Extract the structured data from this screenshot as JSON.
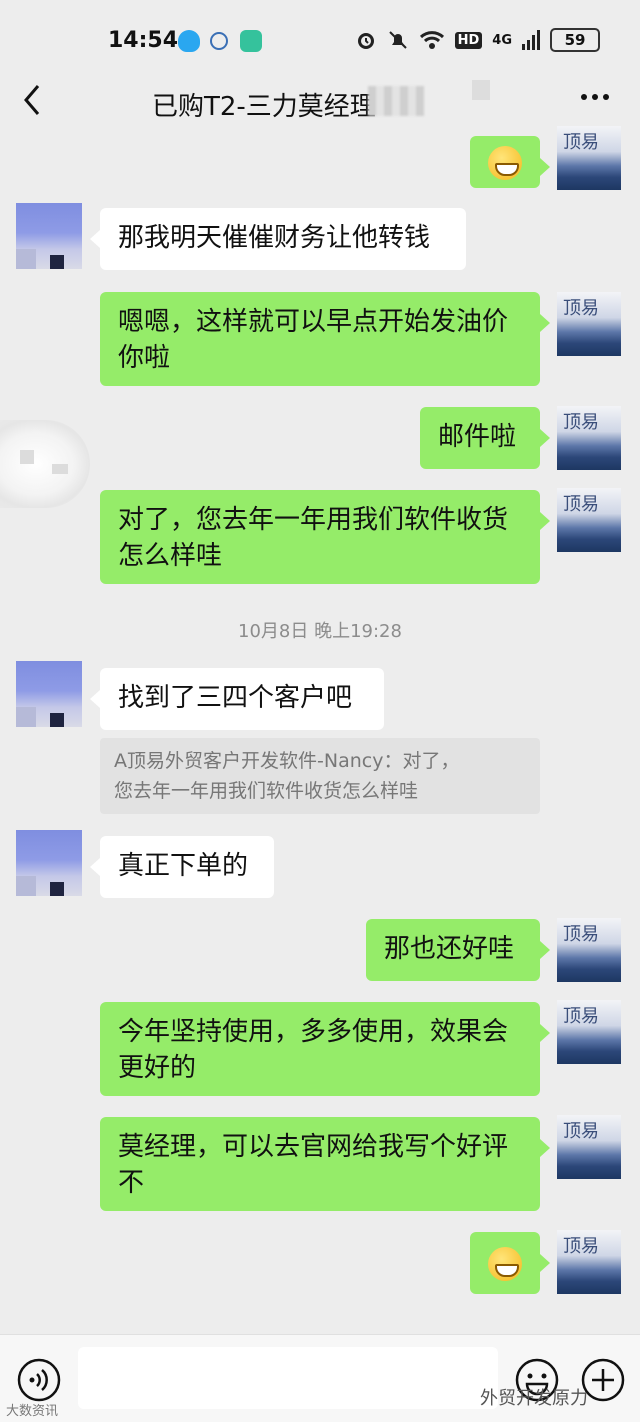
{
  "status": {
    "time": "14:54",
    "signal_label": "4G",
    "hd_label": "HD",
    "battery": "59"
  },
  "header": {
    "title": "已购T2-三力莫经理"
  },
  "messages": [
    {
      "side": "right",
      "type": "emoji",
      "emoji_name": "grin-emoji"
    },
    {
      "side": "left",
      "text": "那我明天催催财务让他转钱"
    },
    {
      "side": "right",
      "text_line1": "嗯嗯，这样就可以早点开始发油价",
      "text_line2": "你啦"
    },
    {
      "side": "right",
      "text": "邮件啦"
    },
    {
      "side": "right",
      "text_line1": "对了，您去年一年用我们软件收货",
      "text_line2": "怎么样哇"
    },
    {
      "side": "left",
      "text": "找到了三四个客户吧"
    },
    {
      "side": "left",
      "text": "真正下单的"
    },
    {
      "side": "right",
      "text": "那也还好哇"
    },
    {
      "side": "right",
      "text_line1": "今年坚持使用，多多使用，效果会",
      "text_line2": "更好的"
    },
    {
      "side": "right",
      "text_line1": "莫经理，可以去官网给我写个好评",
      "text_line2": "不"
    },
    {
      "side": "right",
      "type": "emoji",
      "emoji_name": "grin-emoji"
    }
  ],
  "timestamp": "10月8日 晚上19:28",
  "quote": {
    "line1": "A顶易外贸客户开发软件-Nancy：对了，",
    "line2": "您去年一年用我们软件收货怎么样哇"
  },
  "avatar_right_glyph": "顶易",
  "watermark_left": "大数资讯",
  "watermark_right": "外贸开发原力",
  "colors": {
    "bubble_green": "#95ec69",
    "bubble_white": "#ffffff",
    "background": "#ededed"
  }
}
